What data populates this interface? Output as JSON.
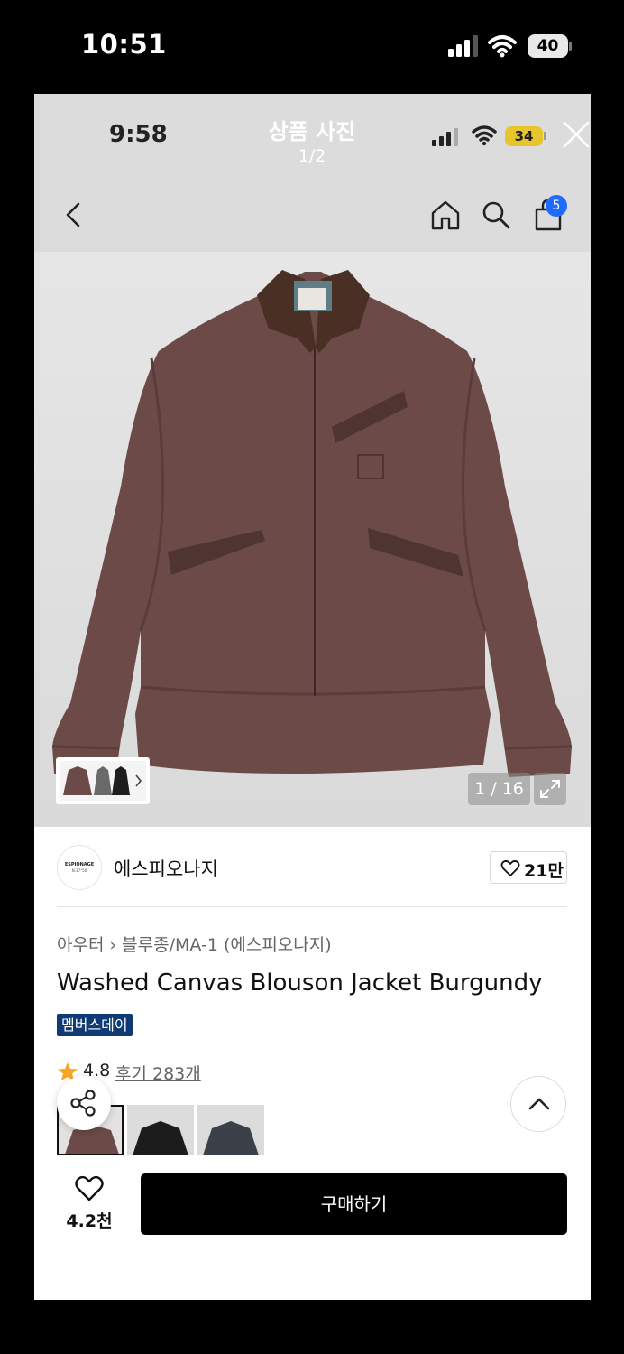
{
  "outer_status": {
    "time": "10:51",
    "battery": "40"
  },
  "viewer": {
    "time": "9:58",
    "title": "상품 사진",
    "counter": "1/2",
    "battery": "34"
  },
  "nav": {
    "cart_count": "5"
  },
  "photo": {
    "counter": "1 / 16"
  },
  "brand": {
    "logo_text": "ESPIONAGE",
    "logo_subtext": "N.37°56",
    "name": "에스피오나지",
    "likes": "21만"
  },
  "breadcrumb": {
    "category": "아우터",
    "separator": "›",
    "subcategory": "블루종/MA-1 (에스피오나지)"
  },
  "product": {
    "title": "Washed Canvas Blouson Jacket Burgundy",
    "badge": "멤버스데이",
    "rating": "4.8",
    "reviews": "후기 283개"
  },
  "bottom_bar": {
    "wish_count": "4.2천",
    "buy_label": "구매하기"
  },
  "colors": {
    "jacket_main": "#6b4a47",
    "collar": "#4a2f24",
    "buy_button": "#000000",
    "badge_bg": "#0f3a73",
    "cart_badge": "#1f6bff"
  },
  "icons": [
    "signal-icon",
    "wifi-icon",
    "battery-icon",
    "close-icon",
    "back-icon",
    "home-icon",
    "search-icon",
    "bag-icon",
    "chevron-right-icon",
    "expand-icon",
    "heart-icon",
    "star-icon",
    "share-icon",
    "chevron-up-icon"
  ]
}
